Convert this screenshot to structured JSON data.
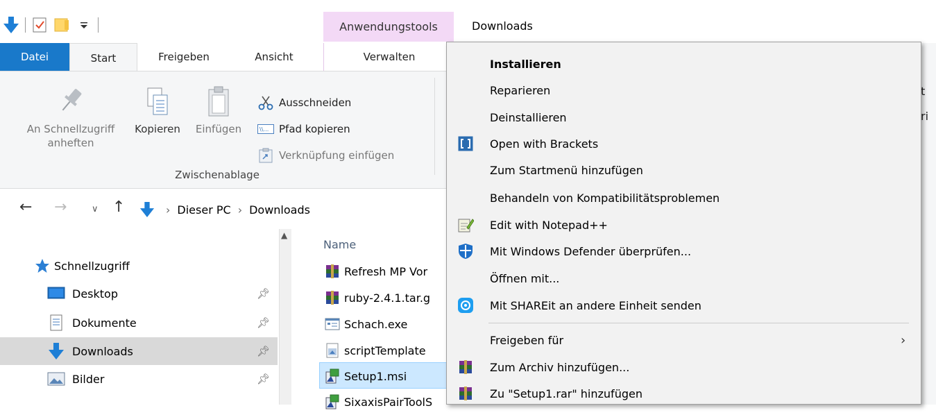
{
  "title": {
    "context_tab": "Anwendungstools",
    "folder": "Downloads"
  },
  "tabs": {
    "datei": "Datei",
    "start": "Start",
    "freigeben": "Freigeben",
    "ansicht": "Ansicht",
    "verwalten": "Verwalten"
  },
  "ribbon": {
    "pin_line1": "An Schnellzugriff",
    "pin_line2": "anheften",
    "copy": "Kopieren",
    "paste": "Einfügen",
    "cut": "Ausschneiden",
    "copy_path": "Pfad kopieren",
    "paste_shortcut": "Verknüpfung einfügen",
    "group_label": "Zwischenablage",
    "cutoff_1": "t",
    "cutoff_2": "ri"
  },
  "address": {
    "crumbs": [
      "Dieser PC",
      "Downloads"
    ]
  },
  "navpane": {
    "items": [
      {
        "label": "Schnellzugriff",
        "icon": "star-icon"
      },
      {
        "label": "Desktop",
        "icon": "desktop-icon",
        "pinned": true
      },
      {
        "label": "Dokumente",
        "icon": "documents-icon",
        "pinned": true
      },
      {
        "label": "Downloads",
        "icon": "download-arrow-icon",
        "pinned": true
      },
      {
        "label": "Bilder",
        "icon": "pictures-icon",
        "pinned": true
      }
    ]
  },
  "filelist": {
    "column_name": "Name",
    "files": [
      {
        "label": "Refresh MP Vor",
        "icon": "archive-icon"
      },
      {
        "label": "ruby-2.4.1.tar.g",
        "icon": "archive-icon"
      },
      {
        "label": "Schach.exe",
        "icon": "exe-icon"
      },
      {
        "label": "scriptTemplate",
        "icon": "script-icon"
      },
      {
        "label": "Setup1.msi",
        "icon": "msi-icon",
        "selected": true
      },
      {
        "label": "SixaxisPairToolS",
        "icon": "msi-icon"
      }
    ]
  },
  "context_menu": {
    "items": [
      {
        "label": "Installieren",
        "bold": true
      },
      {
        "label": "Reparieren"
      },
      {
        "label": "Deinstallieren"
      },
      {
        "label": "Open with Brackets",
        "icon": "brackets-icon"
      },
      {
        "label": "Zum Startmenü hinzufügen"
      },
      {
        "label": "Behandeln von Kompatibilitätsproblemen"
      },
      {
        "label": "Edit with Notepad++",
        "icon": "notepad-icon"
      },
      {
        "label": "Mit Windows Defender überprüfen...",
        "icon": "defender-icon"
      },
      {
        "label": "Öffnen mit..."
      },
      {
        "label": "Mit SHAREit an andere Einheit senden",
        "icon": "shareit-icon"
      },
      {
        "label": "Freigeben für",
        "submenu": true
      },
      {
        "label": "Zum Archiv hinzufügen...",
        "icon": "archive-icon"
      },
      {
        "label": "Zu \"Setup1.rar\" hinzufügen",
        "icon": "archive-icon"
      }
    ]
  },
  "colors": {
    "accent": "#1979ca",
    "context_tab": "#f3d9f6",
    "selection": "#cce8ff"
  }
}
